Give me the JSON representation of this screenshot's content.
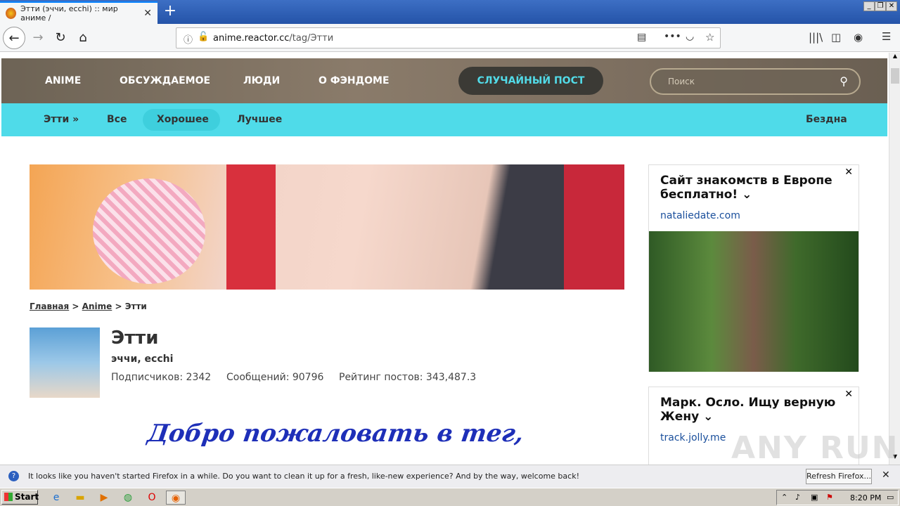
{
  "browser": {
    "tab_title": "Этти (эччи, ecchi) :: мир аниме /",
    "url_domain": "anime.reactor.cc",
    "url_path": "/tag/Этти"
  },
  "nav": {
    "items": [
      "ANIME",
      "ОБСУЖДАЕМОЕ",
      "ЛЮДИ",
      "О ФЭНДОМЕ"
    ],
    "random": "СЛУЧАЙНЫЙ ПОСТ",
    "search_placeholder": "Поиск"
  },
  "subnav": {
    "tag": "Этти »",
    "all": "Все",
    "good": "Хорошее",
    "best": "Лучшее",
    "abyss": "Бездна"
  },
  "breadcrumb": {
    "home": "Главная",
    "sep": ">",
    "section": "Anime",
    "current": "Этти"
  },
  "tag": {
    "name": "Этти",
    "aliases": "эччи, ecchi",
    "subscribers": "Подписчиков: 2342",
    "messages": "Сообщений: 90796",
    "rating": "Рейтинг постов: 343,487.3",
    "welcome": "Добро пожаловать в тег,"
  },
  "ads": [
    {
      "title": "Сайт знакомств в Европе бесплатно!",
      "link": "nataliedate.com"
    },
    {
      "title": "Марк. Осло. Ищу верную Жену",
      "link": "track.jolly.me"
    }
  ],
  "notification": {
    "text": "It looks like you haven't started Firefox in a while. Do you want to clean it up for a fresh, like-new experience? And by the way, welcome back!",
    "button": "Refresh Firefox..."
  },
  "taskbar": {
    "start": "Start",
    "time": "8:20 PM"
  },
  "watermark": "ANY RUN"
}
